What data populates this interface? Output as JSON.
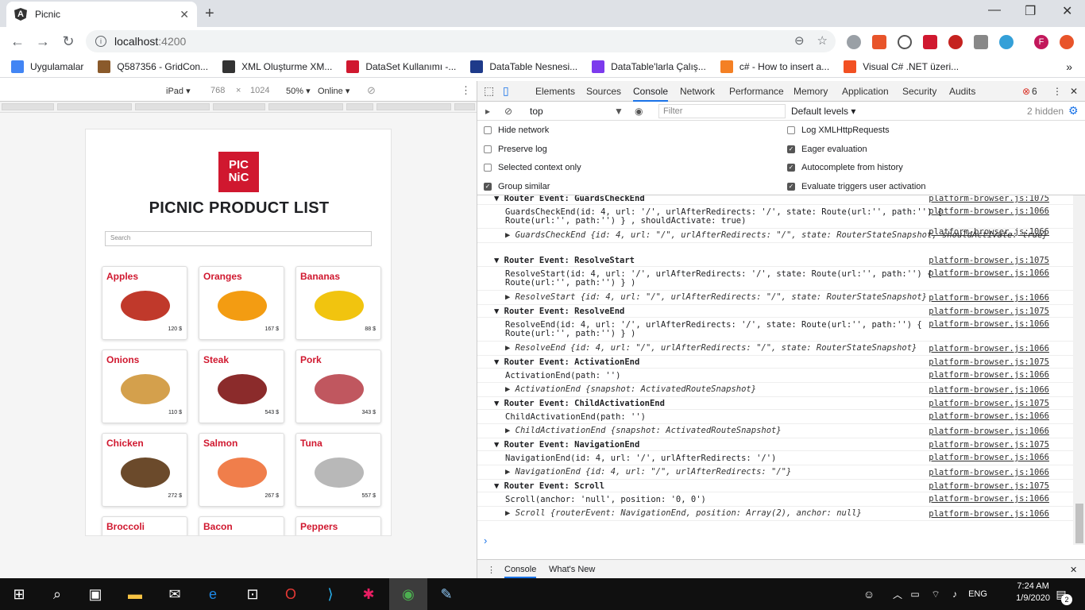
{
  "browser": {
    "tab_title": "Picnic",
    "tab_icon": "A",
    "url_host": "localhost",
    "url_port": ":4200"
  },
  "bookmarks": [
    {
      "label": "Uygulamalar",
      "color": "#4285f4"
    },
    {
      "label": "Q587356 - GridCon...",
      "color": "#8a5a2b"
    },
    {
      "label": "XML Oluşturme XM...",
      "color": "#333333"
    },
    {
      "label": "DataSet Kullanımı -...",
      "color": "#d0182f"
    },
    {
      "label": "DataTable Nesnesi...",
      "color": "#1e3a8a"
    },
    {
      "label": "DataTable'larla Çalış...",
      "color": "#7c3aed"
    },
    {
      "label": "c# - How to insert a...",
      "color": "#f48024"
    },
    {
      "label": "Visual C# .NET üzeri...",
      "color": "#f25022"
    }
  ],
  "device_toolbar": {
    "device": "iPad ▾",
    "width": "768",
    "height": "1024",
    "zoom": "50% ▾",
    "network": "Online ▾"
  },
  "page": {
    "logo_line1": "PIC",
    "logo_line2": "NiC",
    "title": "PICNIC PRODUCT LIST",
    "search_placeholder": "Search",
    "products": [
      {
        "name": "Apples",
        "price": "120 $",
        "color": "#c0392b"
      },
      {
        "name": "Oranges",
        "price": "167 $",
        "color": "#f39c12"
      },
      {
        "name": "Bananas",
        "price": "88 $",
        "color": "#f1c40f"
      },
      {
        "name": "Onions",
        "price": "110 $",
        "color": "#d4a04c"
      },
      {
        "name": "Steak",
        "price": "543 $",
        "color": "#8b2b2b"
      },
      {
        "name": "Pork",
        "price": "343 $",
        "color": "#c0575f"
      },
      {
        "name": "Chicken",
        "price": "272 $",
        "color": "#6b4a2b"
      },
      {
        "name": "Salmon",
        "price": "267 $",
        "color": "#f07e4b"
      },
      {
        "name": "Tuna",
        "price": "557 $",
        "color": "#b8b8b8"
      },
      {
        "name": "Broccoli",
        "price": "",
        "color": "#ffffff"
      },
      {
        "name": "Bacon",
        "price": "",
        "color": "#ffffff"
      },
      {
        "name": "Peppers",
        "price": "",
        "color": "#ffffff"
      }
    ]
  },
  "devtools": {
    "tabs": [
      "Elements",
      "Sources",
      "Console",
      "Network",
      "Performance",
      "Memory",
      "Application",
      "Security",
      "Audits"
    ],
    "active_tab": "Console",
    "error_count": "6",
    "context": "top",
    "filter_placeholder": "Filter",
    "levels": "Default levels ▾",
    "hidden": "2 hidden",
    "settings_left": [
      {
        "label": "Hide network",
        "checked": false
      },
      {
        "label": "Preserve log",
        "checked": false
      },
      {
        "label": "Selected context only",
        "checked": false
      },
      {
        "label": "Group similar",
        "checked": true
      }
    ],
    "settings_right": [
      {
        "label": "Log XMLHttpRequests",
        "checked": false
      },
      {
        "label": "Eager evaluation",
        "checked": true
      },
      {
        "label": "Autocomplete from history",
        "checked": true
      },
      {
        "label": "Evaluate triggers user activation",
        "checked": true
      }
    ],
    "log": [
      {
        "type": "grp",
        "text": "▼ Router Event: GuardsCheckEnd",
        "src": "platform-browser.js:1075"
      },
      {
        "type": "msg",
        "text": "GuardsCheckEnd(id: 4, url: '/', urlAfterRedirects: '/', state: Route(url:'', path:'') {\nRoute(url:'', path:'') } , shouldActivate: true)",
        "src": "platform-browser.js:1066"
      },
      {
        "type": "obj",
        "text": "▶ GuardsCheckEnd {id: 4, url: \"/\", urlAfterRedirects: \"/\", state: RouterStateSnapshot, shouldActivate: true}",
        "src": "platform-browser.js:1066"
      },
      {
        "type": "grp",
        "text": "▼ Router Event: ResolveStart",
        "src": "platform-browser.js:1075"
      },
      {
        "type": "msg",
        "text": "ResolveStart(id: 4, url: '/', urlAfterRedirects: '/', state: Route(url:'', path:'') {\nRoute(url:'', path:'') } )",
        "src": "platform-browser.js:1066"
      },
      {
        "type": "obj",
        "text": "▶ ResolveStart {id: 4, url: \"/\", urlAfterRedirects: \"/\", state: RouterStateSnapshot}",
        "src": "platform-browser.js:1066"
      },
      {
        "type": "grp",
        "text": "▼ Router Event: ResolveEnd",
        "src": "platform-browser.js:1075"
      },
      {
        "type": "msg",
        "text": "ResolveEnd(id: 4, url: '/', urlAfterRedirects: '/', state: Route(url:'', path:'') {\nRoute(url:'', path:'') } )",
        "src": "platform-browser.js:1066"
      },
      {
        "type": "obj",
        "text": "▶ ResolveEnd {id: 4, url: \"/\", urlAfterRedirects: \"/\", state: RouterStateSnapshot}",
        "src": "platform-browser.js:1066"
      },
      {
        "type": "grp",
        "text": "▼ Router Event: ActivationEnd",
        "src": "platform-browser.js:1075"
      },
      {
        "type": "msg",
        "text": "ActivationEnd(path: '')",
        "src": "platform-browser.js:1066"
      },
      {
        "type": "obj",
        "text": "▶ ActivationEnd {snapshot: ActivatedRouteSnapshot}",
        "src": "platform-browser.js:1066"
      },
      {
        "type": "grp",
        "text": "▼ Router Event: ChildActivationEnd",
        "src": "platform-browser.js:1075"
      },
      {
        "type": "msg",
        "text": "ChildActivationEnd(path: '')",
        "src": "platform-browser.js:1066"
      },
      {
        "type": "obj",
        "text": "▶ ChildActivationEnd {snapshot: ActivatedRouteSnapshot}",
        "src": "platform-browser.js:1066"
      },
      {
        "type": "grp",
        "text": "▼ Router Event: NavigationEnd",
        "src": "platform-browser.js:1075"
      },
      {
        "type": "msg",
        "text": "NavigationEnd(id: 4, url: '/', urlAfterRedirects: '/')",
        "src": "platform-browser.js:1066"
      },
      {
        "type": "obj",
        "text": "▶ NavigationEnd {id: 4, url: \"/\", urlAfterRedirects: \"/\"}",
        "src": "platform-browser.js:1066"
      },
      {
        "type": "grp",
        "text": "▼ Router Event: Scroll",
        "src": "platform-browser.js:1075"
      },
      {
        "type": "msg",
        "text": "Scroll(anchor: 'null', position: '0, 0')",
        "src": "platform-browser.js:1066"
      },
      {
        "type": "obj",
        "text": "▶ Scroll {routerEvent: NavigationEnd, position: Array(2), anchor: null}",
        "src": "platform-browser.js:1066"
      }
    ],
    "prompt": "›",
    "drawer_tabs": [
      "Console",
      "What's New"
    ]
  },
  "taskbar": {
    "time": "7:24 AM",
    "date": "1/9/2020",
    "lang": "ENG",
    "notif": "2"
  }
}
